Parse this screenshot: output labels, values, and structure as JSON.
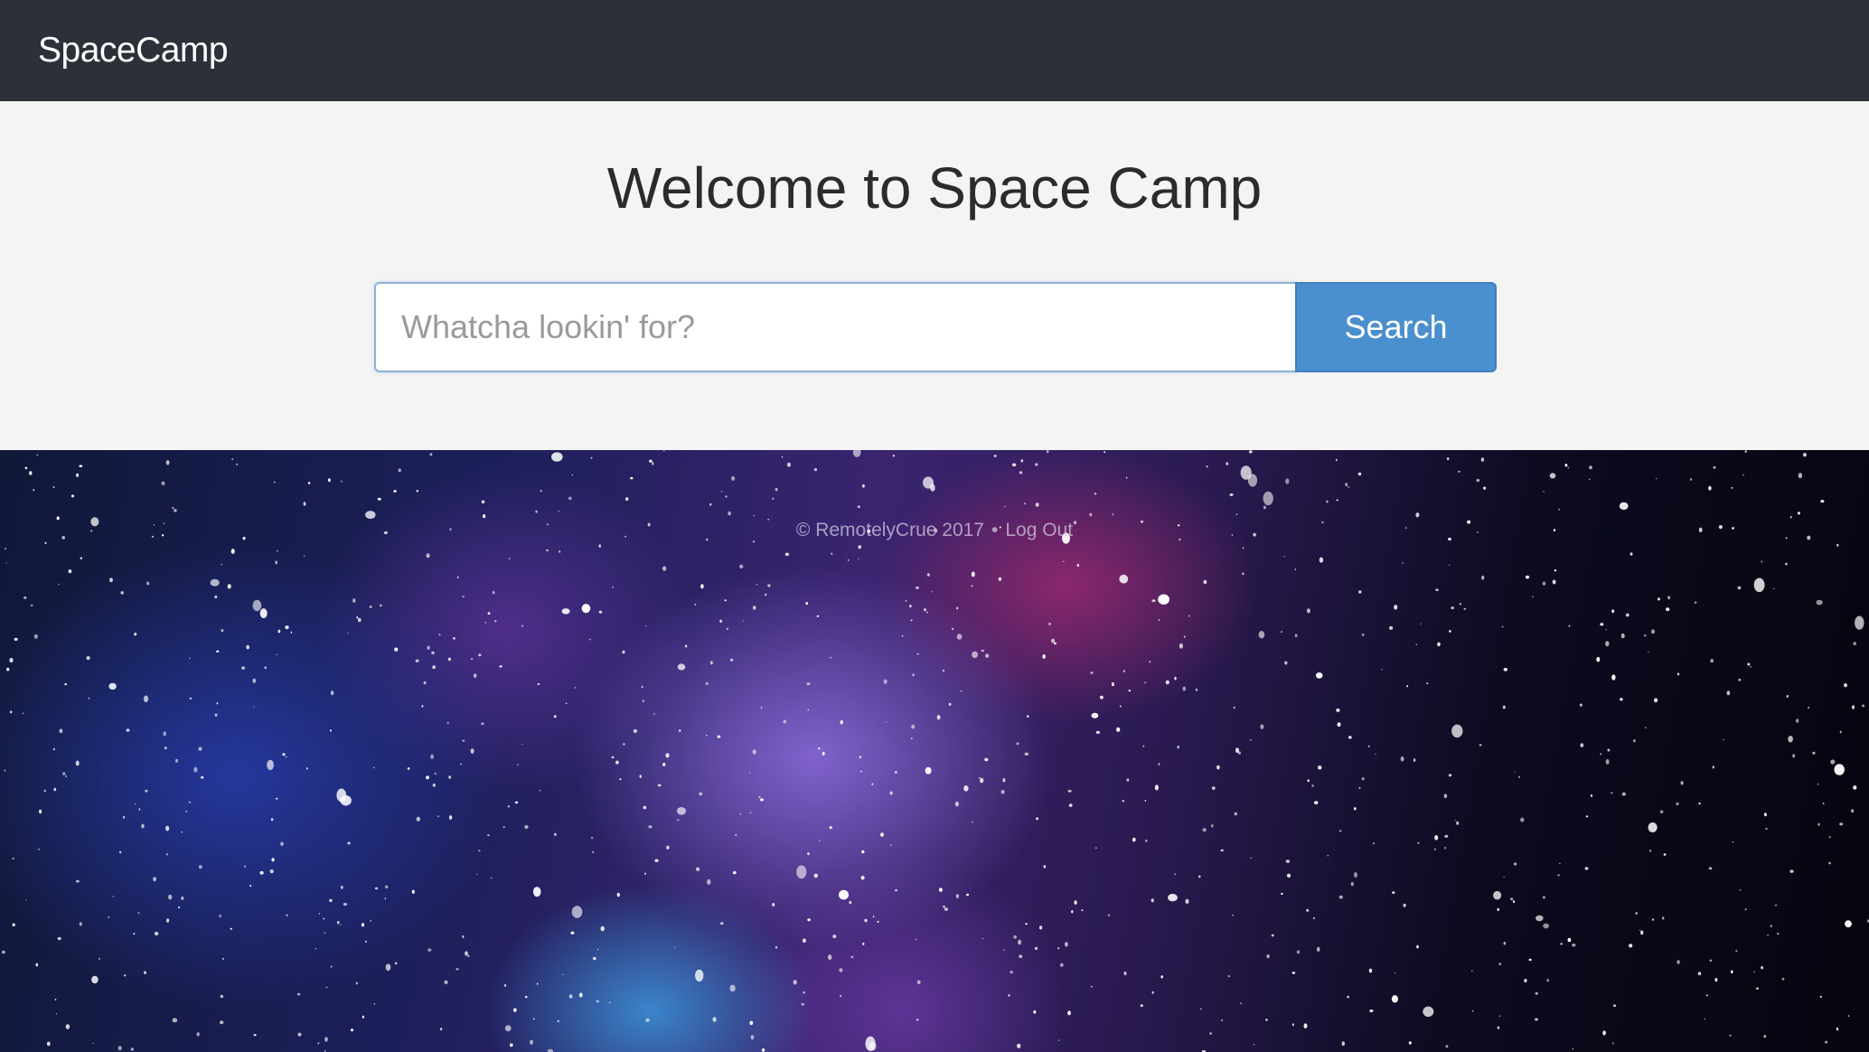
{
  "navbar": {
    "brand": "SpaceCamp"
  },
  "hero": {
    "title": "Welcome to Space Camp",
    "search": {
      "placeholder": "Whatcha lookin' for?",
      "value": "",
      "button_label": "Search"
    }
  },
  "footer": {
    "copyright": "© RemotelyCrue 2017",
    "separator": "•",
    "logout_label": "Log Out"
  },
  "colors": {
    "navbar_bg": "#2c3039",
    "hero_bg": "#f4f4f4",
    "button_bg": "#4a8fce"
  }
}
